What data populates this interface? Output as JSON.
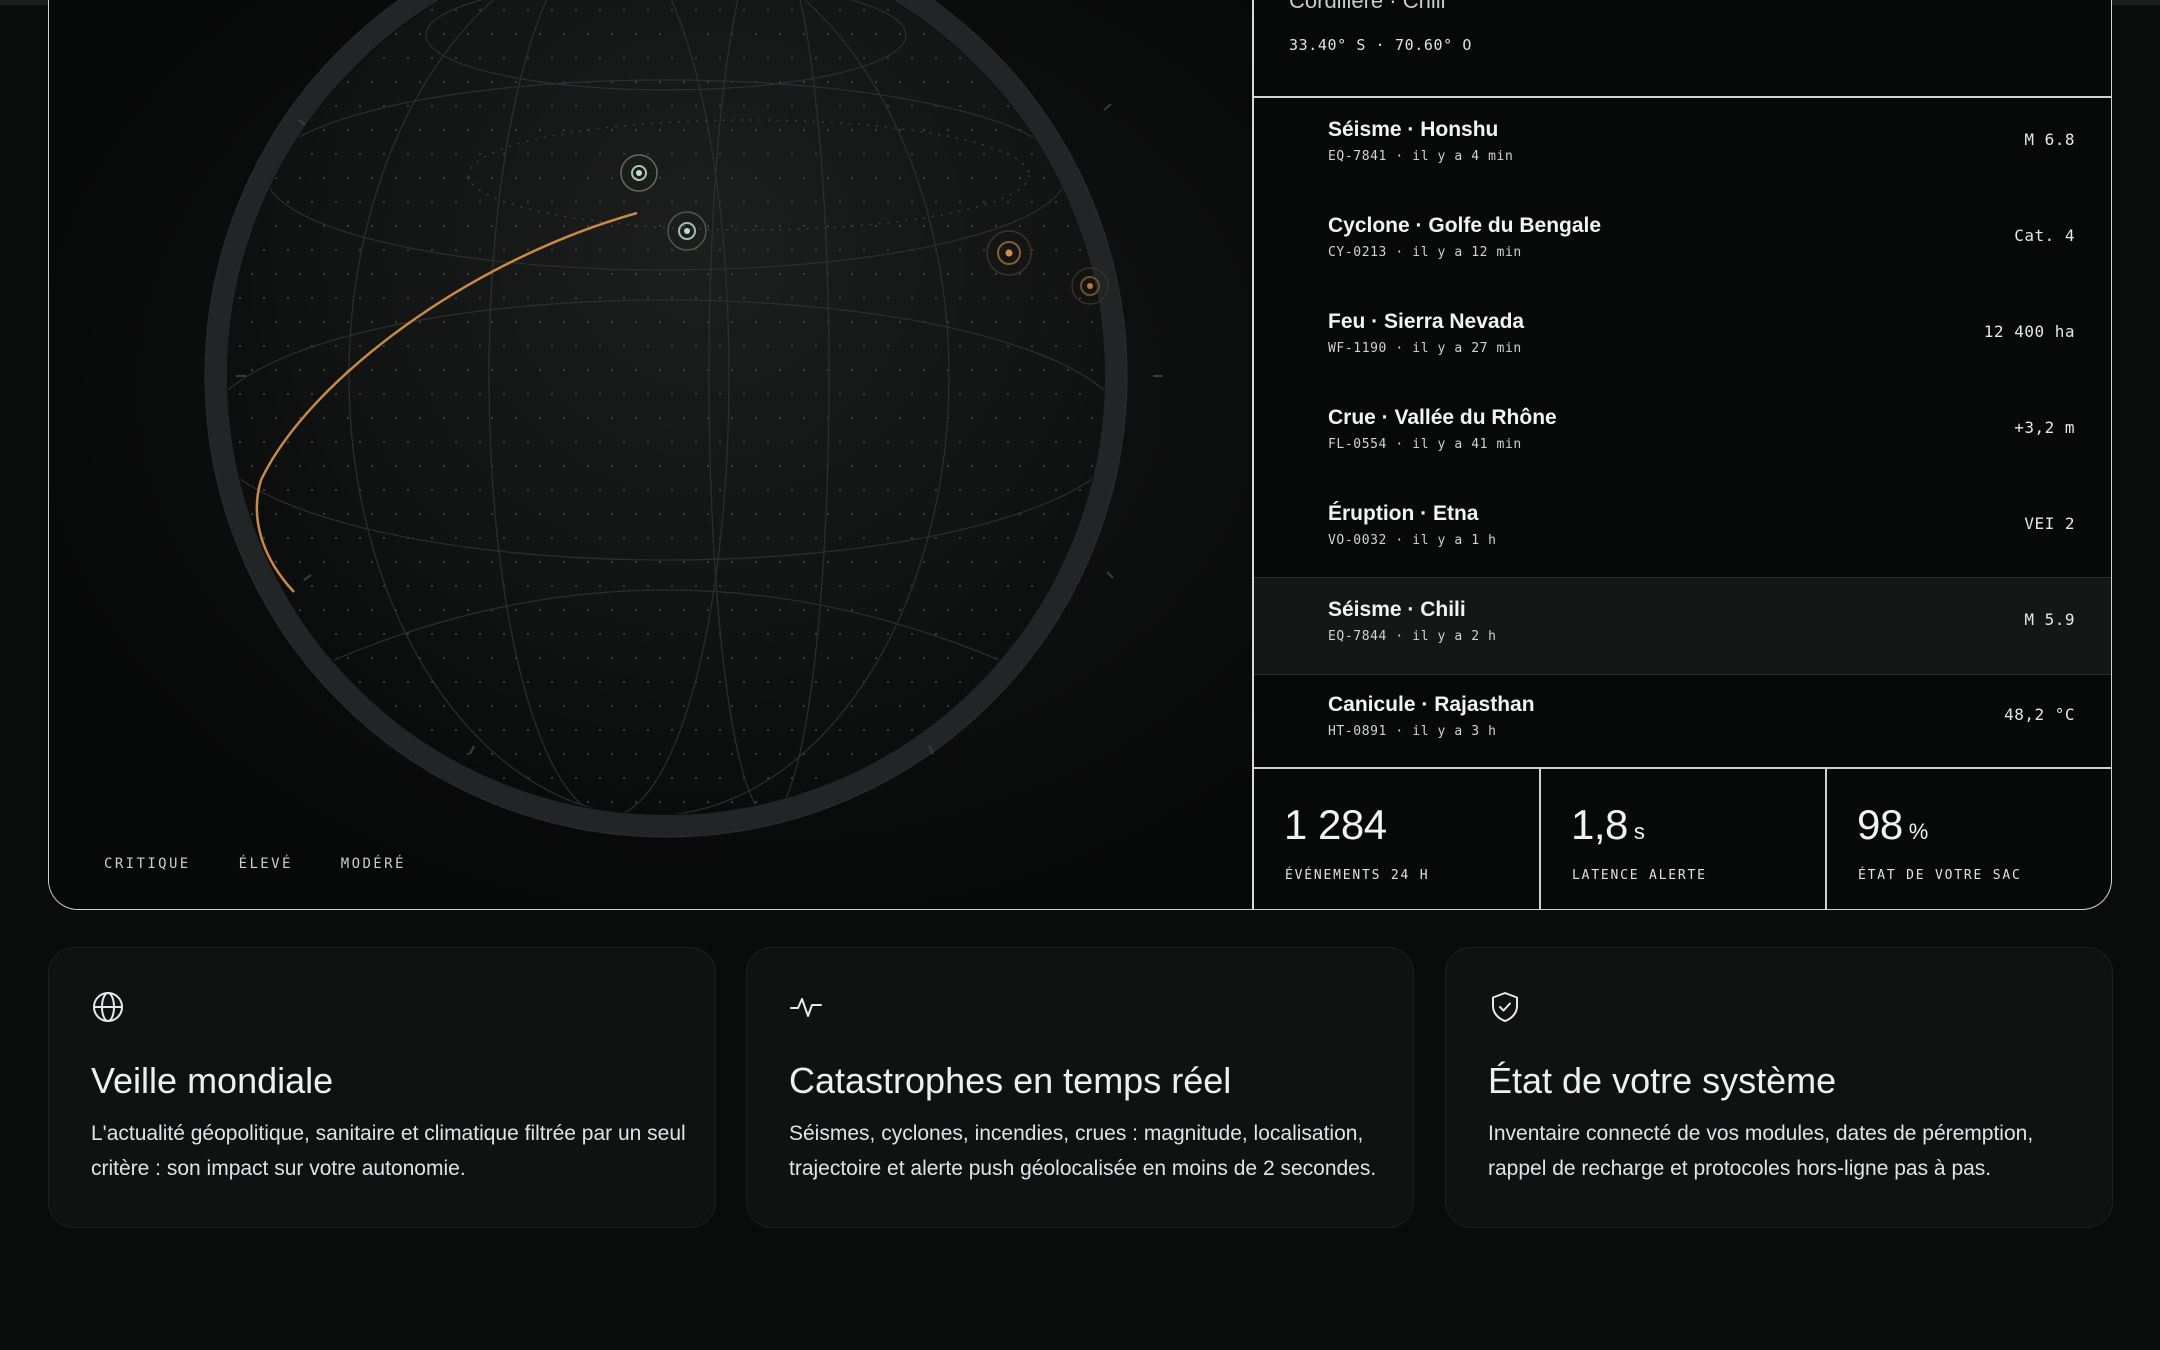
{
  "location": {
    "title": "Cordillère · Chili",
    "coords": "33.40° S · 70.60° O"
  },
  "legend": [
    "CRITIQUE",
    "ÉLEVÉ",
    "MODÉRÉ"
  ],
  "events": [
    {
      "title": "Séisme · Honshu",
      "meta": "EQ-7841 · il y a 4 min",
      "value": "M 6.8"
    },
    {
      "title": "Cyclone · Golfe du Bengale",
      "meta": "CY-0213 · il y a 12 min",
      "value": "Cat. 4"
    },
    {
      "title": "Feu · Sierra Nevada",
      "meta": "WF-1190 · il y a 27 min",
      "value": "12 400 ha"
    },
    {
      "title": "Crue · Vallée du Rhône",
      "meta": "FL-0554 · il y a 41 min",
      "value": "+3,2 m"
    },
    {
      "title": "Éruption · Etna",
      "meta": "VO-0032 · il y a 1 h",
      "value": "VEI 2"
    },
    {
      "title": "Séisme · Chili",
      "meta": "EQ-7844 · il y a 2 h",
      "value": "M 5.9"
    },
    {
      "title": "Canicule · Rajasthan",
      "meta": "HT-0891 · il y a 3 h",
      "value": "48,2 °C"
    }
  ],
  "selected_event_index": 5,
  "stats": [
    {
      "value": "1 284",
      "unit": "",
      "label": "ÉVÉNEMENTS 24 H"
    },
    {
      "value": "1,8",
      "unit": "s",
      "label": "LATENCE ALERTE"
    },
    {
      "value": "98",
      "unit": "%",
      "label": "ÉTAT DE VOTRE SAC"
    }
  ],
  "cards": [
    {
      "icon": "globe-icon",
      "title": "Veille mondiale",
      "text": "L'actualité géopolitique, sanitaire et climatique filtrée par un seul critère : son impact sur votre autonomie."
    },
    {
      "icon": "pulse-icon",
      "title": "Catastrophes en temps réel",
      "text": "Séismes, cyclones, incendies, crues : magnitude, localisation, trajectoire et alerte push géolocalisée en moins de 2 secondes."
    },
    {
      "icon": "shield-check-icon",
      "title": "État de votre système",
      "text": "Inventaire connecté de vos modules, dates de péremption, rappel de recharge et protocoles hors-ligne pas à pas."
    }
  ],
  "colors": {
    "accent_orange": "#c98a45",
    "marker_green": "#a9c9a4",
    "background": "#0a0b0b",
    "border": "#cfd3d3"
  }
}
